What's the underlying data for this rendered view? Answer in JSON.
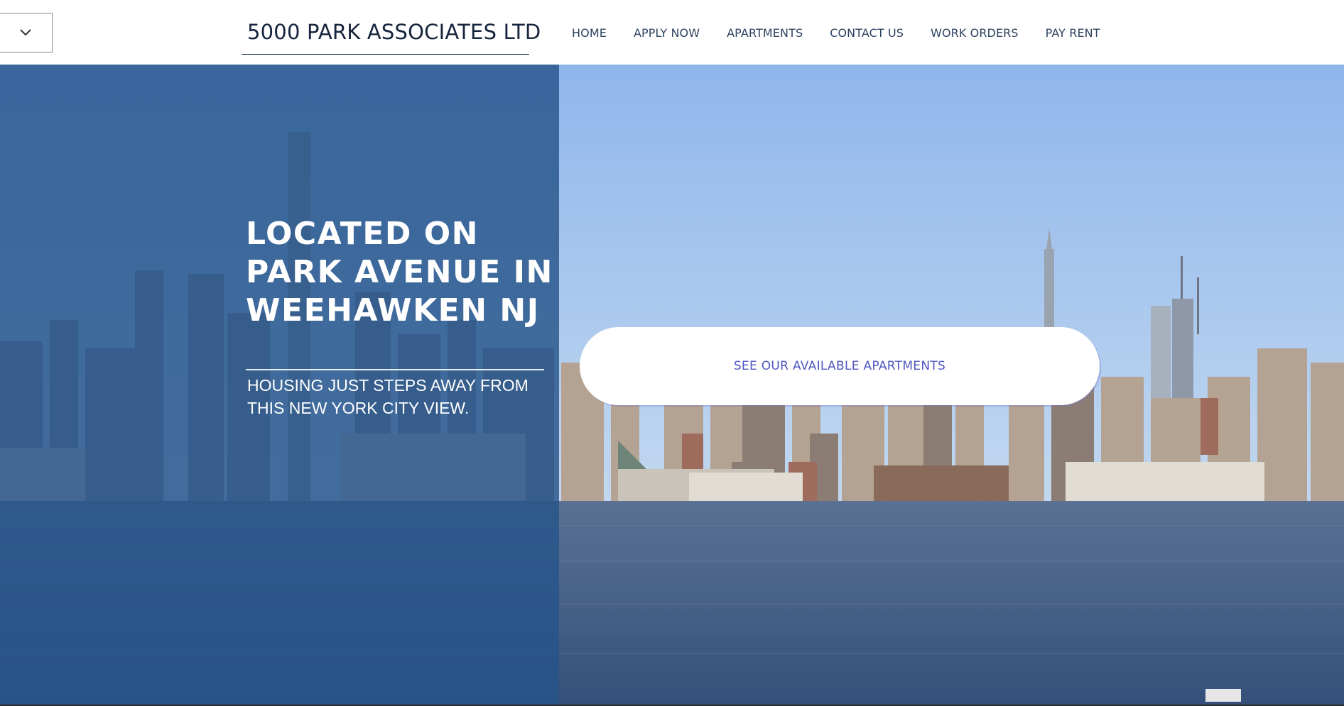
{
  "header": {
    "brand": "5000 PARK ASSOCIATES LTD",
    "dropdown_icon": "chevron-down-icon",
    "nav": [
      {
        "label": "HOME"
      },
      {
        "label": "APPLY NOW"
      },
      {
        "label": "APARTMENTS"
      },
      {
        "label": "CONTACT US"
      },
      {
        "label": "WORK ORDERS"
      },
      {
        "label": "PAY RENT"
      }
    ]
  },
  "hero": {
    "headline": "LOCATED ON PARK AVENUE IN WEEHAWKEN NJ",
    "subheadline": "HOUSING JUST STEPS AWAY FROM THIS NEW YORK CITY VIEW.",
    "cta_label": "SEE OUR AVAILABLE APARTMENTS",
    "background_image": "new-york-city-skyline-over-river"
  },
  "colors": {
    "overlay": "#26548a",
    "brand_text": "#16243d",
    "nav_text": "#2e4360",
    "cta_text": "#4e56c0",
    "sky": "#a9c9ee",
    "water": "#3f5a80"
  }
}
